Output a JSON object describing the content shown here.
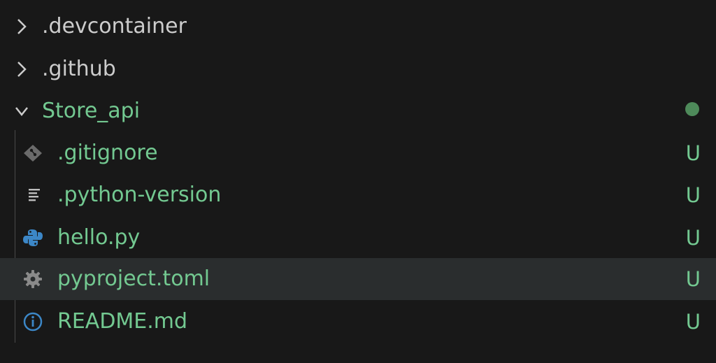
{
  "tree": {
    "folders": [
      {
        "label": ".devcontainer",
        "expanded": false,
        "color": "#cccccc"
      },
      {
        "label": ".github",
        "expanded": false,
        "color": "#cccccc"
      },
      {
        "label": "Store_api",
        "expanded": true,
        "color": "#73c991",
        "badge": "modified-dot"
      }
    ],
    "files": [
      {
        "label": ".gitignore",
        "icon": "git-icon",
        "status": "U"
      },
      {
        "label": ".python-version",
        "icon": "text-lines-icon",
        "status": "U"
      },
      {
        "label": "hello.py",
        "icon": "python-icon",
        "status": "U"
      },
      {
        "label": "pyproject.toml",
        "icon": "gear-icon",
        "status": "U",
        "hovered": true
      },
      {
        "label": "README.md",
        "icon": "info-icon",
        "status": "U"
      }
    ]
  },
  "colors": {
    "untracked": "#73c991",
    "background": "#181818",
    "hover_background": "#2a2d2e",
    "python_blue": "#3c87c7",
    "info_blue": "#3c87c7",
    "icon_gray": "#8a8a8a"
  }
}
